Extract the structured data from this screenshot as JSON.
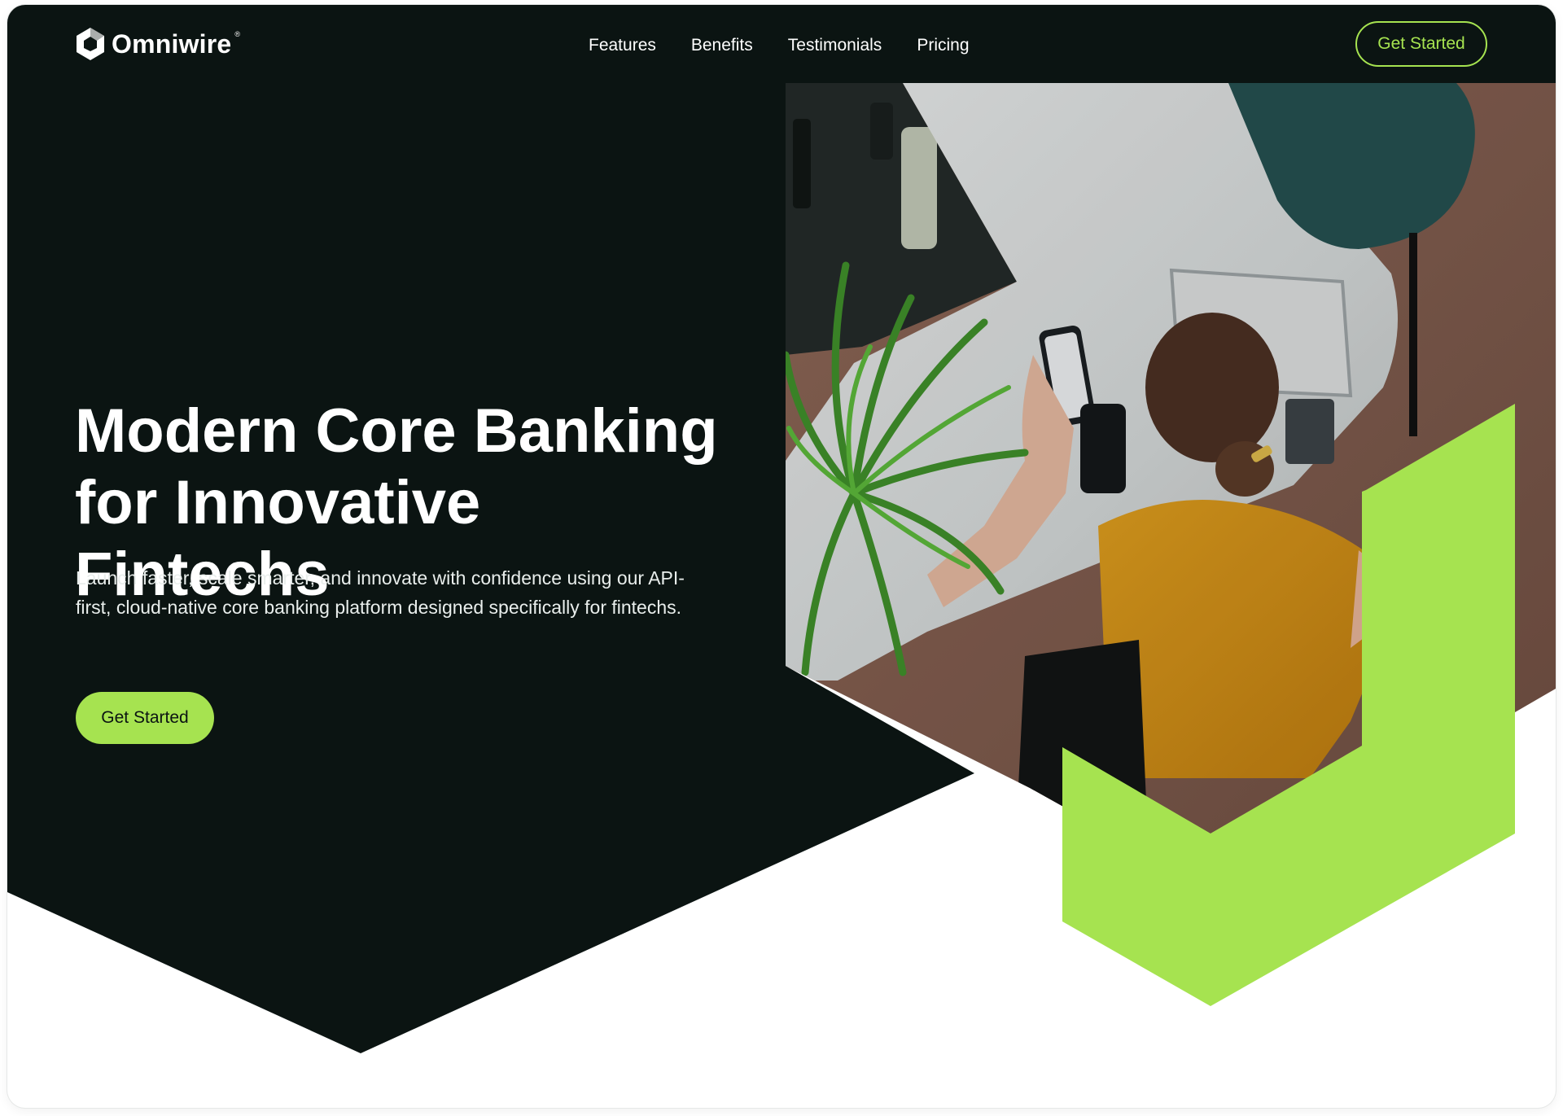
{
  "brand": {
    "name": "Omniwire",
    "registered_mark": "®"
  },
  "nav": {
    "links": [
      {
        "label": "Features"
      },
      {
        "label": "Benefits"
      },
      {
        "label": "Testimonials"
      },
      {
        "label": "Pricing"
      }
    ],
    "cta_label": "Get Started"
  },
  "hero": {
    "title_line1": "Modern Core Banking",
    "title_line2": "for Innovative Fintechs",
    "subtitle": "Launch faster, scale smarter, and innovate with confidence using our API-first, cloud-native core banking platform designed specifically for fintechs.",
    "cta_label": "Get Started",
    "image_subject": "woman at marble desk using phone"
  },
  "colors": {
    "dark_bg": "#0b1412",
    "accent_green": "#a6e350",
    "white": "#ffffff"
  },
  "icons": {
    "logo": "hexagon-logo-icon"
  }
}
